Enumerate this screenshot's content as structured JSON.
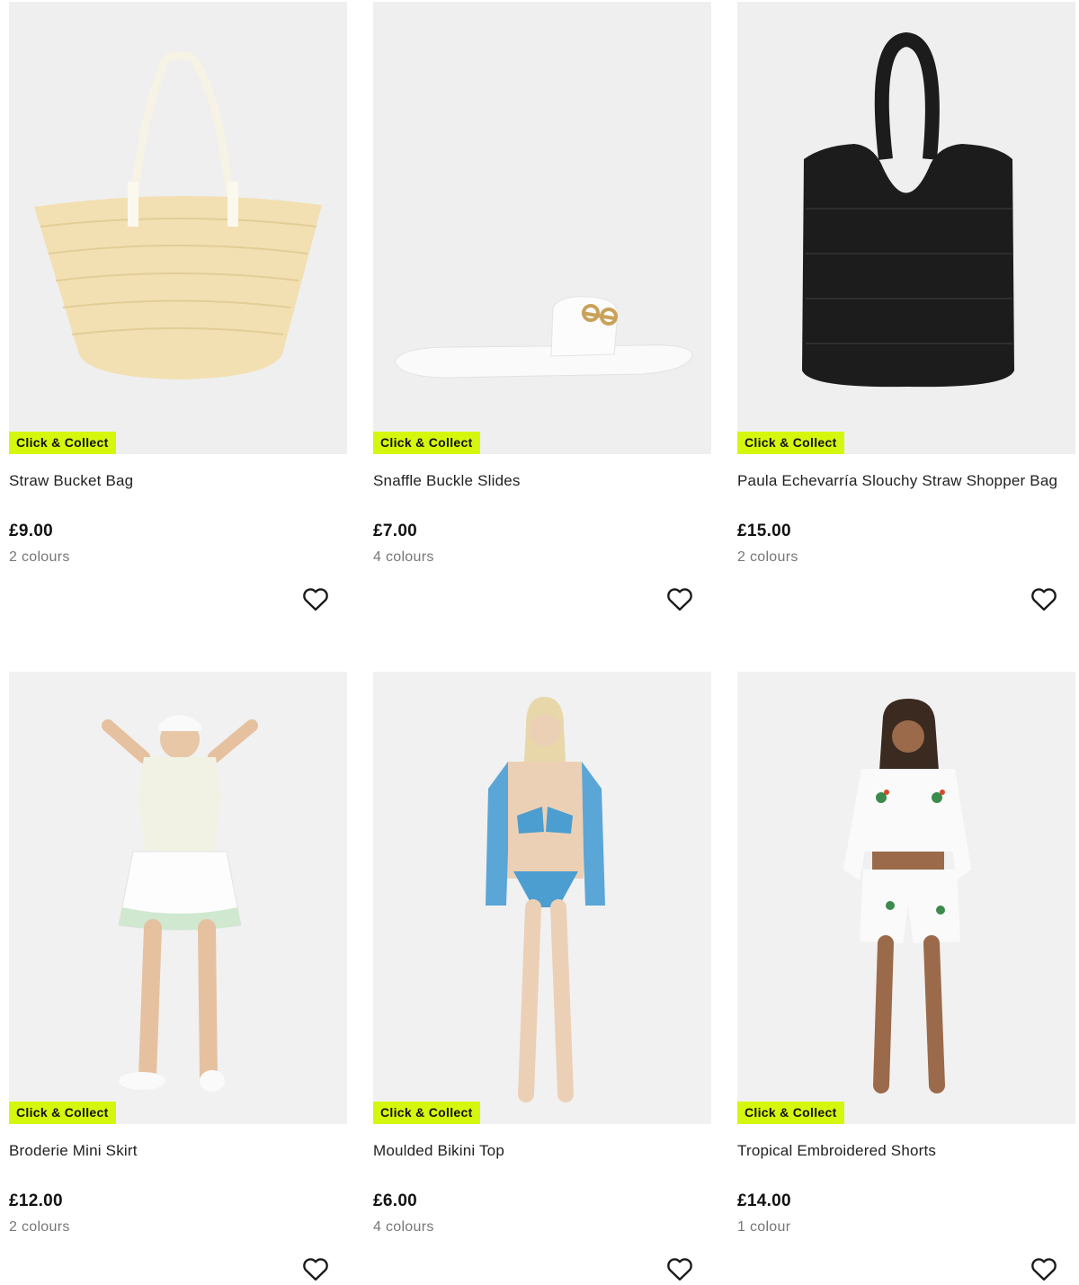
{
  "products": [
    {
      "name": "Straw Bucket Bag",
      "price": "£9.00",
      "colours": "2 colours",
      "badge": "Click & Collect"
    },
    {
      "name": "Snaffle Buckle Slides",
      "price": "£7.00",
      "colours": "4 colours",
      "badge": "Click & Collect"
    },
    {
      "name": "Paula Echevarría Slouchy Straw Shopper Bag",
      "price": "£15.00",
      "colours": "2 colours",
      "badge": "Click & Collect"
    },
    {
      "name": "Broderie Mini Skirt",
      "price": "£12.00",
      "colours": "2 colours",
      "badge": "Click & Collect"
    },
    {
      "name": "Moulded Bikini Top",
      "price": "£6.00",
      "colours": "4 colours",
      "badge": "Click & Collect"
    },
    {
      "name": "Tropical Embroidered Shorts",
      "price": "£14.00",
      "colours": "1 colour",
      "badge": "Click & Collect"
    }
  ],
  "colors": {
    "badge_bg": "#d5f70e",
    "image_bg": "#efefef",
    "price": "#111111",
    "muted": "#777777"
  },
  "icons": {
    "wishlist": "heart-outline-icon"
  }
}
